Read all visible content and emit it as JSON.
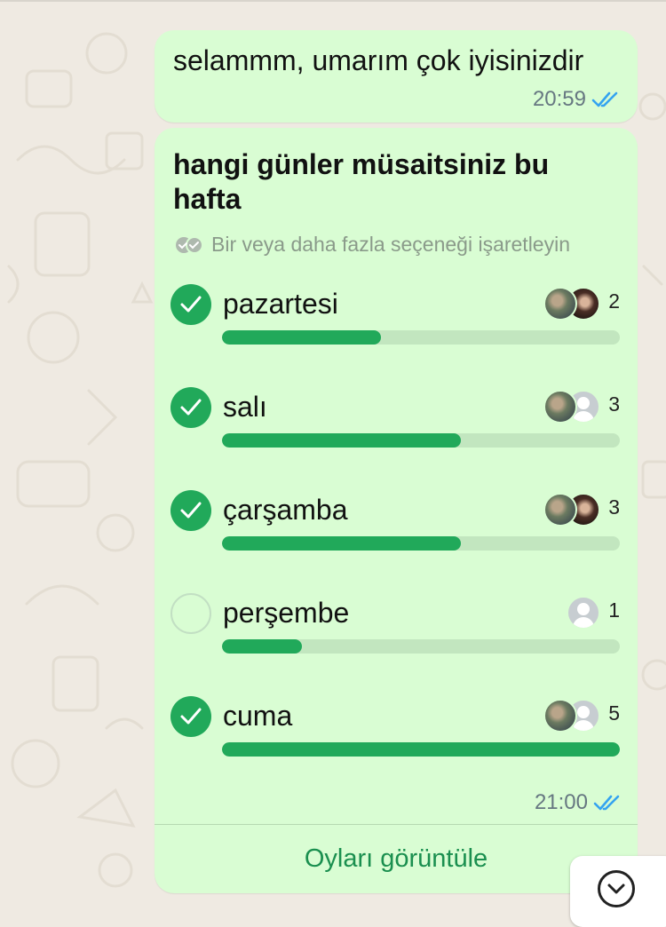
{
  "messages": {
    "greeting": {
      "text": "selammm, umarım çok iyisinizdir",
      "time": "20:59",
      "status_icon": "double-check-read-icon"
    }
  },
  "poll": {
    "question": "hangi günler müsaitsiniz bu hafta",
    "hint": "Bir veya daha fazla seçeneği işaretleyin",
    "options": [
      {
        "label": "pazartesi",
        "votes": "2",
        "fill_fraction": 0.4,
        "checked": true
      },
      {
        "label": "salı",
        "votes": "3",
        "fill_fraction": 0.6,
        "checked": true
      },
      {
        "label": "çarşamba",
        "votes": "3",
        "fill_fraction": 0.6,
        "checked": true
      },
      {
        "label": "perşembe",
        "votes": "1",
        "fill_fraction": 0.2,
        "checked": false
      },
      {
        "label": "cuma",
        "votes": "5",
        "fill_fraction": 1.0,
        "checked": true
      }
    ],
    "time": "21:00",
    "status_icon": "double-check-read-icon",
    "view_votes_label": "Oyları görüntüle"
  },
  "colors": {
    "bubble": "#d9fdd3",
    "accent": "#21a95a",
    "track": "#c2e6bf",
    "read_ticks": "#34a3f0",
    "chat_background": "#efeae2"
  },
  "scroll_button": {
    "icon": "chevron-down-circle-icon"
  }
}
